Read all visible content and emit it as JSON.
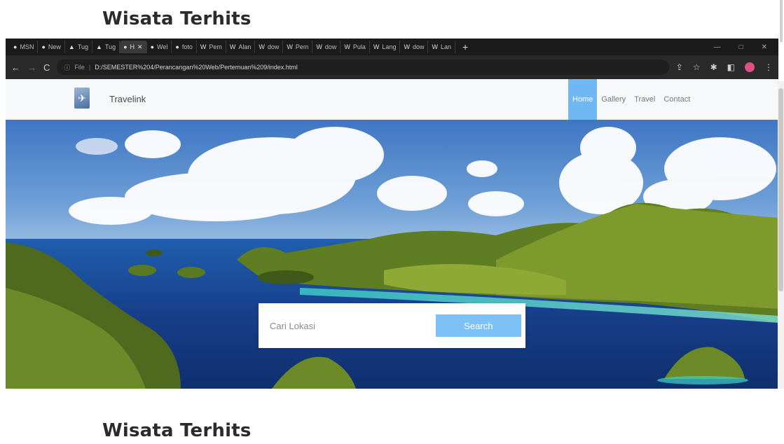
{
  "page": {
    "heading_top": "Wisata Terhits",
    "heading_bottom": "Wisata Terhits"
  },
  "browser": {
    "tabs": [
      {
        "icon": "msn-icon",
        "label": "MSN"
      },
      {
        "icon": "github-icon",
        "label": "New"
      },
      {
        "icon": "drive-icon",
        "label": "Tug"
      },
      {
        "icon": "drive-icon",
        "label": "Tug"
      },
      {
        "icon": "page-icon",
        "label": "H",
        "active": true
      },
      {
        "icon": "globe-icon",
        "label": "Wel"
      },
      {
        "icon": "globe-icon",
        "label": "foto"
      },
      {
        "icon": "wikipedia-icon",
        "label": "Pem"
      },
      {
        "icon": "wikipedia-icon",
        "label": "Alan"
      },
      {
        "icon": "wikipedia-icon",
        "label": "dow"
      },
      {
        "icon": "wikipedia-icon",
        "label": "Pem"
      },
      {
        "icon": "wikipedia-icon",
        "label": "dow"
      },
      {
        "icon": "wikipedia-icon",
        "label": "Pula"
      },
      {
        "icon": "wikipedia-icon",
        "label": "Lang"
      },
      {
        "icon": "wikipedia-icon",
        "label": "dow"
      },
      {
        "icon": "wikipedia-icon",
        "label": "Lan"
      }
    ],
    "url_prefix": "File",
    "url": "D:/SEMESTER%204/Perancangan%20Web/Pertemuan%209/index.html"
  },
  "site": {
    "brand": "Travelink",
    "menu": [
      {
        "label": "Home",
        "active": true
      },
      {
        "label": "Gallery",
        "active": false
      },
      {
        "label": "Travel",
        "active": false
      },
      {
        "label": "Contact",
        "active": false
      }
    ],
    "search": {
      "placeholder": "Cari Lokasi",
      "button": "Search"
    }
  },
  "colors": {
    "accent": "#6fb8f4",
    "button": "#7cc1f7",
    "nav_bg": "#f7f8fa"
  }
}
